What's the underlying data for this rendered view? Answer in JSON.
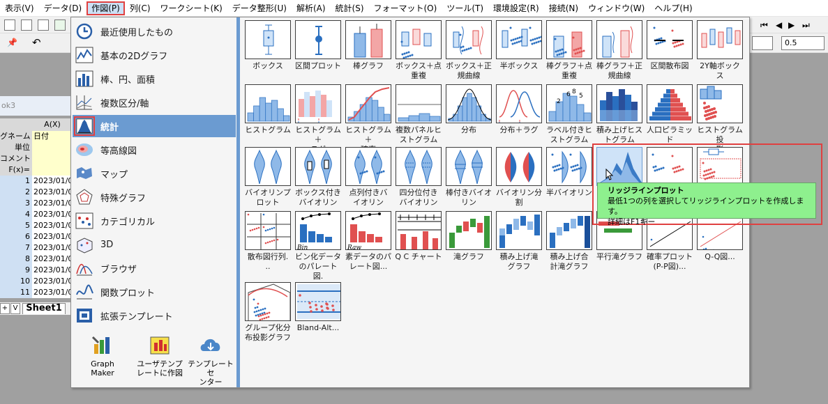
{
  "menu": {
    "items": [
      "表示(V)",
      "データ(D)",
      "作図(P)",
      "列(C)",
      "ワークシート(K)",
      "データ整形(U)",
      "解析(A)",
      "統計(S)",
      "フォーマット(O)",
      "ツール(T)",
      "環境設定(R)",
      "接続(N)",
      "ウィンドウ(W)",
      "ヘルプ(H)"
    ],
    "active_index": 2
  },
  "toolbar": {
    "line_width_value": "0.5"
  },
  "worksheet": {
    "title_fragment": "ok3",
    "column_header": "A(X)",
    "meta_rows": [
      {
        "label": "グネーム",
        "value": "日付"
      },
      {
        "label": "単位",
        "value": ""
      },
      {
        "label": "コメント",
        "value": ""
      },
      {
        "label": "F(x)=",
        "value": ""
      }
    ],
    "data_rows": [
      {
        "label": "1",
        "value": "2023/01/0"
      },
      {
        "label": "2",
        "value": "2023/01/0"
      },
      {
        "label": "3",
        "value": "2023/01/0"
      },
      {
        "label": "4",
        "value": "2023/01/0"
      },
      {
        "label": "5",
        "value": "2023/01/0"
      },
      {
        "label": "6",
        "value": "2023/01/0"
      },
      {
        "label": "7",
        "value": "2023/01/0"
      },
      {
        "label": "8",
        "value": "2023/01/0"
      },
      {
        "label": "9",
        "value": "2023/01/0"
      },
      {
        "label": "10",
        "value": "2023/01/0"
      },
      {
        "label": "11",
        "value": "2023/01/0"
      }
    ],
    "sheet_tab": "Sheet1"
  },
  "categories": [
    {
      "label": "最近使用したもの",
      "icon": "clock-icon"
    },
    {
      "label": "基本の2Dグラフ",
      "icon": "line-graph-icon"
    },
    {
      "label": "棒、円、面積",
      "icon": "bar-chart-icon"
    },
    {
      "label": "複数区分/軸",
      "icon": "multi-axis-icon"
    },
    {
      "label": "統計",
      "icon": "statistics-icon",
      "selected": true
    },
    {
      "label": "等高線図",
      "icon": "contour-icon"
    },
    {
      "label": "マップ",
      "icon": "map-icon"
    },
    {
      "label": "特殊グラフ",
      "icon": "pentagon-icon"
    },
    {
      "label": "カテゴリカル",
      "icon": "categorical-icon"
    },
    {
      "label": "3D",
      "icon": "cube-3d-icon"
    },
    {
      "label": "ブラウザ",
      "icon": "browser-icon"
    },
    {
      "label": "関数プロット",
      "icon": "function-plot-icon"
    },
    {
      "label": "拡張テンプレート",
      "icon": "template-icon"
    }
  ],
  "bottom_tools": [
    {
      "label": "Graph Maker",
      "icon": "graph-maker-icon"
    },
    {
      "label": "ユーザテンプ\nレートに作図",
      "icon": "user-template-icon"
    },
    {
      "label": "テンプレートセ\nンター",
      "icon": "cloud-download-icon"
    }
  ],
  "gallery": [
    {
      "caption": "ボックス",
      "kind": "box"
    },
    {
      "caption": "区間プロット",
      "kind": "interval"
    },
    {
      "caption": "棒グラフ",
      "kind": "bar"
    },
    {
      "caption": "ボックス＋点\n重複",
      "kind": "boxdots"
    },
    {
      "caption": "ボックス＋正\n規曲線",
      "kind": "boxnormal"
    },
    {
      "caption": "半ボックス",
      "kind": "halfbox"
    },
    {
      "caption": "棒グラフ＋点\n重複",
      "kind": "bardots"
    },
    {
      "caption": "棒グラフ＋正\n規曲線",
      "kind": "barnormal"
    },
    {
      "caption": "区間散布図",
      "kind": "intervalscatter"
    },
    {
      "caption": "2Y軸ボックス",
      "kind": "box2y"
    },
    {
      "caption": "ヒストグラム",
      "kind": "hist"
    },
    {
      "caption": "ヒストグラム＋\nラグ",
      "kind": "histrug"
    },
    {
      "caption": "ヒストグラム＋\n確率",
      "kind": "histprob"
    },
    {
      "caption": "複数パネルヒ\nストグラム",
      "kind": "multipanel"
    },
    {
      "caption": "分布",
      "kind": "dist"
    },
    {
      "caption": "分布＋ラグ",
      "kind": "distrug"
    },
    {
      "caption": "ラベル付きヒ\nストグラム",
      "kind": "labelhist"
    },
    {
      "caption": "積み上げヒス\nトグラム",
      "kind": "stackhist"
    },
    {
      "caption": "人口ピラミッド",
      "kind": "pyramid"
    },
    {
      "caption": "ヒストグラム投\n影",
      "kind": "histproj"
    },
    {
      "caption": "バイオリンプ\nロット",
      "kind": "violin"
    },
    {
      "caption": "ボックス付き\nバイオリン",
      "kind": "violinbox"
    },
    {
      "caption": "点列付きバ\nイオリン",
      "kind": "violinpts"
    },
    {
      "caption": "四分位付き\nバイオリン",
      "kind": "violinq"
    },
    {
      "caption": "棒付きバイオ\nリン",
      "kind": "violinbar"
    },
    {
      "caption": "バイオリン分\n割",
      "kind": "violinsplit"
    },
    {
      "caption": "半バイオリン",
      "kind": "halfviolin"
    },
    {
      "caption": "リッ",
      "kind": "ridge"
    },
    {
      "caption": "",
      "kind": "beeswarm"
    },
    {
      "caption": "",
      "kind": "scatterbox"
    },
    {
      "caption": "散布図行列.\n..",
      "kind": "scattermatrix"
    },
    {
      "caption": "ビン化データ\nのパレート図.\n..",
      "kind": "paretobin"
    },
    {
      "caption": "素データのパ\nレート図...",
      "kind": "paretoraw"
    },
    {
      "caption": "Q C チャート",
      "kind": "qc"
    },
    {
      "caption": "滝グラフ",
      "kind": "waterfall"
    },
    {
      "caption": "積み上げ滝\nグラフ",
      "kind": "stackwaterfall"
    },
    {
      "caption": "積み上げ合\n計滝グラフ",
      "kind": "stacktotalwaterfall"
    },
    {
      "caption": "平行滝グラフ",
      "kind": "parallelwaterfall"
    },
    {
      "caption": "確率プロット\n(P-P図)...",
      "kind": "pp"
    },
    {
      "caption": "Q-Q図...",
      "kind": "qq"
    },
    {
      "caption": "グループ化分\n布投影グラフ",
      "kind": "groupproj"
    },
    {
      "caption": "Bland-Alt...",
      "kind": "blandaltman"
    }
  ],
  "tooltip": {
    "title": "リッジラインプロット",
    "line1": "最低1つの列を選択してリッジラインプロットを作成します。",
    "line2": "詳細はF1キー"
  },
  "colors": {
    "accent": "#6b9bd1",
    "highlight": "#e04040",
    "tooltip_bg": "#8ef08e"
  }
}
